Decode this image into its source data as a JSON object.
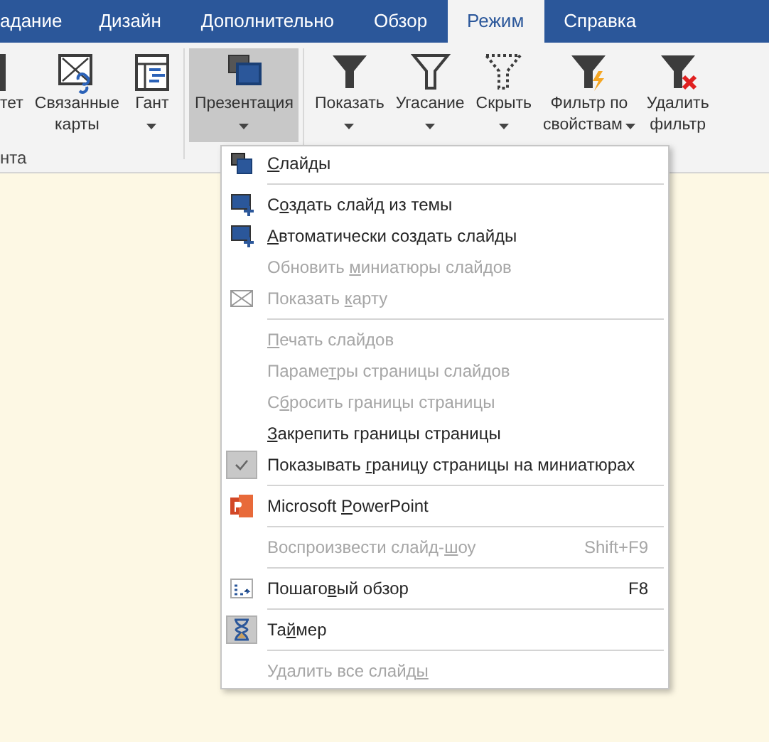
{
  "tabs": [
    {
      "label": "адание",
      "selected": false
    },
    {
      "label": "Дизайн",
      "selected": false
    },
    {
      "label": "Дополнительно",
      "selected": false
    },
    {
      "label": "Обзор",
      "selected": false
    },
    {
      "label": "Режим",
      "selected": true
    },
    {
      "label": "Справка",
      "selected": false
    }
  ],
  "ribbon": {
    "buttons": [
      {
        "lines": [
          "тет"
        ],
        "caret": false,
        "selected": false
      },
      {
        "lines": [
          "Связанные",
          "карты"
        ],
        "caret": false,
        "selected": false
      },
      {
        "lines": [
          "Гант"
        ],
        "caret": true,
        "selected": false
      },
      {
        "lines": [
          "Презентация"
        ],
        "caret": true,
        "selected": true
      },
      {
        "lines": [
          "Показать"
        ],
        "caret": true,
        "selected": false
      },
      {
        "lines": [
          "Угасание"
        ],
        "caret": true,
        "selected": false
      },
      {
        "lines": [
          "Скрыть"
        ],
        "caret": true,
        "selected": false
      },
      {
        "lines": [
          "Фильтр по",
          "свойствам"
        ],
        "caret": true,
        "selected": false
      },
      {
        "lines": [
          "Удалить",
          "фильтр"
        ],
        "caret": false,
        "selected": false
      }
    ],
    "group_label": "нта"
  },
  "menu": [
    {
      "kind": "item",
      "key": "С",
      "post": "лайды",
      "disabled": false,
      "checked": false
    },
    {
      "kind": "separator"
    },
    {
      "kind": "item",
      "pre": "С",
      "key": "о",
      "post": "здать слайд из темы",
      "disabled": false,
      "checked": false
    },
    {
      "kind": "item",
      "key": "А",
      "post": "втоматически создать слайды",
      "disabled": false,
      "checked": false
    },
    {
      "kind": "item",
      "pre": "Обновить ",
      "key": "м",
      "post": "иниатюры слайдов",
      "disabled": true,
      "checked": false
    },
    {
      "kind": "item",
      "pre": "Показать ",
      "key": "к",
      "post": "арту",
      "disabled": true,
      "checked": false
    },
    {
      "kind": "separator"
    },
    {
      "kind": "item",
      "key": "П",
      "post": "ечать слайдов",
      "disabled": true,
      "checked": false
    },
    {
      "kind": "item",
      "pre": "Параме",
      "key": "т",
      "post": "ры страницы слайдов",
      "disabled": true,
      "checked": false
    },
    {
      "kind": "item",
      "pre": "С",
      "key": "б",
      "post": "росить границы страницы",
      "disabled": true,
      "checked": false
    },
    {
      "kind": "item",
      "key": "З",
      "post": "акрепить границы страницы",
      "disabled": false,
      "checked": false
    },
    {
      "kind": "item",
      "pre": "Показывать ",
      "key": "г",
      "post": "раницу страницы на миниатюрах",
      "disabled": false,
      "checked": true
    },
    {
      "kind": "separator"
    },
    {
      "kind": "item",
      "pre": "Microsoft ",
      "key": "P",
      "post": "owerPoint",
      "disabled": false,
      "checked": false
    },
    {
      "kind": "separator"
    },
    {
      "kind": "item",
      "pre": "Воспроизвести слайд-",
      "key": "ш",
      "post": "оу",
      "disabled": true,
      "checked": false,
      "shortcut": "Shift+F9"
    },
    {
      "kind": "separator"
    },
    {
      "kind": "item",
      "pre": "Пошаго",
      "key": "в",
      "post": "ый обзор",
      "disabled": false,
      "checked": false,
      "shortcut": "F8"
    },
    {
      "kind": "separator"
    },
    {
      "kind": "item",
      "pre": "Та",
      "key": "й",
      "post": "мер",
      "disabled": false,
      "checked": true
    },
    {
      "kind": "separator"
    },
    {
      "kind": "item",
      "pre": "Удалить все слайд",
      "key": "ы",
      "disabled": true,
      "checked": false
    }
  ]
}
